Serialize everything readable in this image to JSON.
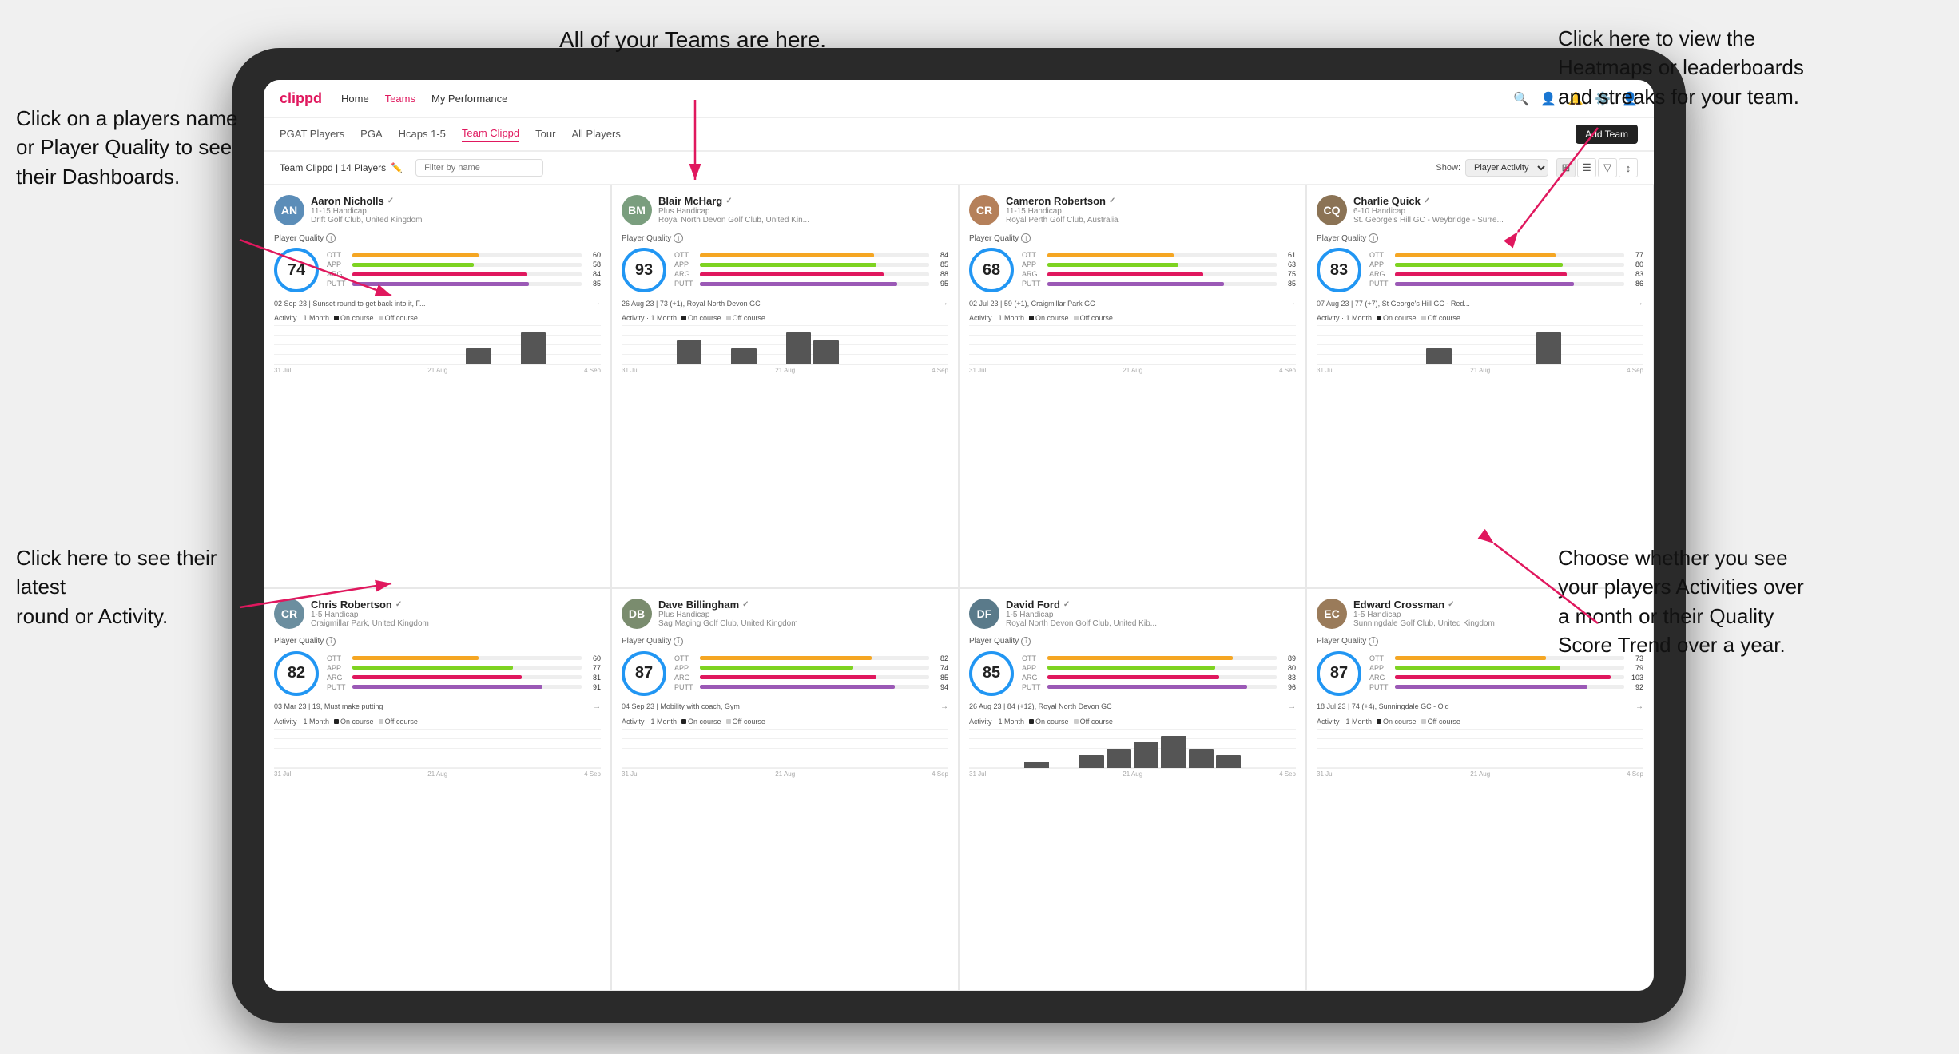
{
  "annotations": {
    "ann1": "Click on a players name\nor Player Quality to see\ntheir Dashboards.",
    "ann2": "All of your Teams are here.",
    "ann3": "Click here to view the\nHeatmaps or leaderboards\nand streaks for your team.",
    "ann4": "Click here to see their latest\nround or Activity.",
    "ann5": "Choose whether you see\nyour players Activities over\na month or their Quality\nScore Trend over a year."
  },
  "nav": {
    "logo": "clippd",
    "links": [
      "Home",
      "Teams",
      "My Performance"
    ],
    "active_link": "Teams"
  },
  "tabs": {
    "items": [
      "PGAT Players",
      "PGA",
      "Hcaps 1-5",
      "Team Clippd",
      "Tour",
      "All Players"
    ],
    "active": "Team Clippd",
    "add_button": "Add Team"
  },
  "filter": {
    "team_label": "Team Clippd | 14 Players",
    "search_placeholder": "Filter by name",
    "show_label": "Show:",
    "show_value": "Player Activity"
  },
  "players": [
    {
      "name": "Aaron Nicholls",
      "handicap": "11-15 Handicap",
      "club": "Drift Golf Club, United Kingdom",
      "color": "#5b8db8",
      "initials": "AN",
      "quality": 74,
      "stats": {
        "ott": 60,
        "app": 58,
        "arg": 84,
        "putt": 85
      },
      "latest_round": "02 Sep 23 | Sunset round to get back into it, F...",
      "activity_bars": [
        0,
        0,
        0,
        0,
        0,
        0,
        0,
        1,
        0,
        2,
        0,
        0
      ],
      "dates": [
        "31 Jul",
        "21 Aug",
        "4 Sep"
      ]
    },
    {
      "name": "Blair McHarg",
      "handicap": "Plus Handicap",
      "club": "Royal North Devon Golf Club, United Kin...",
      "color": "#7a9e7e",
      "initials": "BM",
      "quality": 93,
      "stats": {
        "ott": 84,
        "app": 85,
        "arg": 88,
        "putt": 95
      },
      "latest_round": "26 Aug 23 | 73 (+1), Royal North Devon GC",
      "activity_bars": [
        0,
        0,
        3,
        0,
        2,
        0,
        4,
        3,
        0,
        0,
        0,
        0
      ],
      "dates": [
        "31 Jul",
        "21 Aug",
        "4 Sep"
      ]
    },
    {
      "name": "Cameron Robertson",
      "handicap": "11-15 Handicap",
      "club": "Royal Perth Golf Club, Australia",
      "color": "#b5805a",
      "initials": "CR",
      "quality": 68,
      "stats": {
        "ott": 61,
        "app": 63,
        "arg": 75,
        "putt": 85
      },
      "latest_round": "02 Jul 23 | 59 (+1), Craigmillar Park GC",
      "activity_bars": [
        0,
        0,
        0,
        0,
        0,
        0,
        0,
        0,
        0,
        0,
        0,
        0
      ],
      "dates": [
        "31 Jul",
        "21 Aug",
        "4 Sep"
      ]
    },
    {
      "name": "Charlie Quick",
      "handicap": "6-10 Handicap",
      "club": "St. George's Hill GC - Weybridge - Surre...",
      "color": "#8b7355",
      "initials": "CQ",
      "quality": 83,
      "stats": {
        "ott": 77,
        "app": 80,
        "arg": 83,
        "putt": 86
      },
      "latest_round": "07 Aug 23 | 77 (+7), St George's Hill GC - Red...",
      "activity_bars": [
        0,
        0,
        0,
        0,
        1,
        0,
        0,
        0,
        2,
        0,
        0,
        0
      ],
      "dates": [
        "31 Jul",
        "21 Aug",
        "4 Sep"
      ]
    },
    {
      "name": "Chris Robertson",
      "handicap": "1-5 Handicap",
      "club": "Craigmillar Park, United Kingdom",
      "color": "#6b8e9f",
      "initials": "CR",
      "quality": 82,
      "stats": {
        "ott": 60,
        "app": 77,
        "arg": 81,
        "putt": 91
      },
      "latest_round": "03 Mar 23 | 19, Must make putting",
      "activity_bars": [
        0,
        0,
        0,
        0,
        0,
        0,
        0,
        0,
        0,
        0,
        0,
        0
      ],
      "dates": [
        "31 Jul",
        "21 Aug",
        "4 Sep"
      ]
    },
    {
      "name": "Dave Billingham",
      "handicap": "Plus Handicap",
      "club": "Sag Maging Golf Club, United Kingdom",
      "color": "#7a8c6e",
      "initials": "DB",
      "quality": 87,
      "stats": {
        "ott": 82,
        "app": 74,
        "arg": 85,
        "putt": 94
      },
      "latest_round": "04 Sep 23 | Mobility with coach, Gym",
      "activity_bars": [
        0,
        0,
        0,
        0,
        0,
        0,
        0,
        0,
        0,
        0,
        0,
        0
      ],
      "dates": [
        "31 Jul",
        "21 Aug",
        "4 Sep"
      ]
    },
    {
      "name": "David Ford",
      "handicap": "1-5 Handicap",
      "club": "Royal North Devon Golf Club, United Kib...",
      "color": "#5a7a8a",
      "initials": "DF",
      "quality": 85,
      "stats": {
        "ott": 89,
        "app": 80,
        "arg": 83,
        "putt": 96
      },
      "latest_round": "26 Aug 23 | 84 (+12), Royal North Devon GC",
      "activity_bars": [
        0,
        0,
        1,
        0,
        2,
        3,
        4,
        5,
        3,
        2,
        0,
        0
      ],
      "dates": [
        "31 Jul",
        "21 Aug",
        "4 Sep"
      ]
    },
    {
      "name": "Edward Crossman",
      "handicap": "1-5 Handicap",
      "club": "Sunningdale Golf Club, United Kingdom",
      "color": "#9a7b5a",
      "initials": "EC",
      "quality": 87,
      "stats": {
        "ott": 73,
        "app": 79,
        "arg": 103,
        "putt": 92
      },
      "latest_round": "18 Jul 23 | 74 (+4), Sunningdale GC - Old",
      "activity_bars": [
        0,
        0,
        0,
        0,
        0,
        0,
        0,
        0,
        0,
        0,
        0,
        0
      ],
      "dates": [
        "31 Jul",
        "21 Aug",
        "4 Sep"
      ]
    }
  ],
  "activity": {
    "label": "Activity · 1 Month",
    "on_course": "On course",
    "off_course": "Off course"
  }
}
